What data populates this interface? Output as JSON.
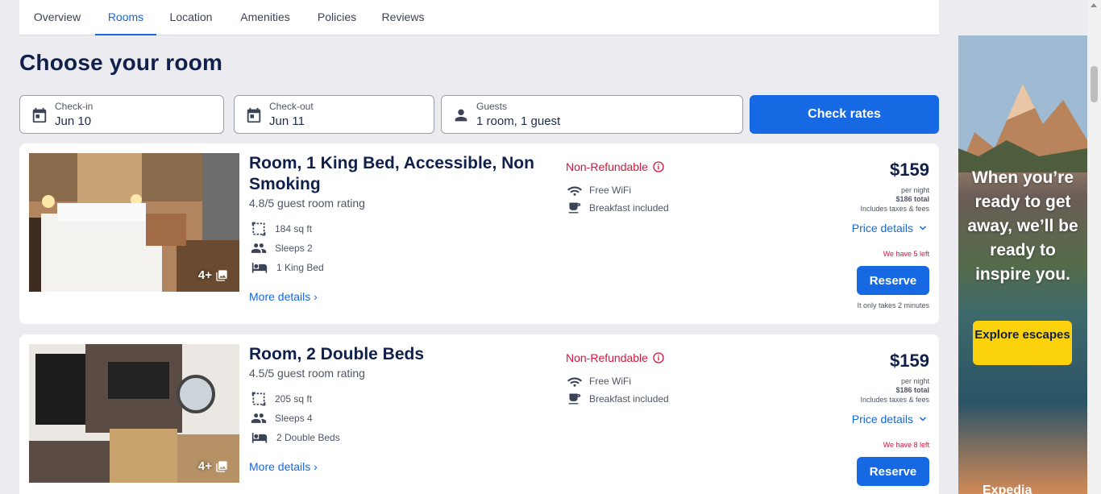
{
  "tabs": [
    {
      "label": "Overview",
      "active": false
    },
    {
      "label": "Rooms",
      "active": true
    },
    {
      "label": "Location",
      "active": false
    },
    {
      "label": "Amenities",
      "active": false
    },
    {
      "label": "Policies",
      "active": false
    },
    {
      "label": "Reviews",
      "active": false
    }
  ],
  "page_title": "Choose your room",
  "search": {
    "checkin": {
      "label": "Check-in",
      "value": "Jun 10",
      "icon": "calendar-icon"
    },
    "checkout": {
      "label": "Check-out",
      "value": "Jun 11",
      "icon": "calendar-icon"
    },
    "guests": {
      "label": "Guests",
      "value": "1 room, 1 guest",
      "icon": "person-icon"
    },
    "button_label": "Check rates"
  },
  "rooms": [
    {
      "name": "Room, 1 King Bed, Accessible, Non Smoking",
      "rating": "4.8/5 guest room rating",
      "photo_count": "4+",
      "size": "184 sq ft",
      "sleeps": "Sleeps 2",
      "beds": "1 King Bed",
      "more_details": "More details",
      "refund_policy": "Non-Refundable",
      "amenities": [
        "Free WiFi",
        "Breakfast included"
      ],
      "price": "$159",
      "per_night": "per night",
      "total": "$186 total",
      "taxes": "Includes taxes & fees",
      "price_details": "Price details",
      "availability": "We have 5 left",
      "reserve_label": "Reserve",
      "takes": "It only takes 2 minutes"
    },
    {
      "name": "Room, 2 Double Beds",
      "rating": "4.5/5 guest room rating",
      "photo_count": "4+",
      "size": "205 sq ft",
      "sleeps": "Sleeps 4",
      "beds": "2 Double Beds",
      "more_details": "More details",
      "refund_policy": "Non-Refundable",
      "amenities": [
        "Free WiFi",
        "Breakfast included"
      ],
      "price": "$159",
      "per_night": "per night",
      "total": "$186 total",
      "taxes": "Includes taxes & fees",
      "price_details": "Price details",
      "availability": "We have 8 left",
      "reserve_label": "Reserve"
    }
  ],
  "ad": {
    "headline": "When you’re ready to get away, we’ll be ready to inspire you.",
    "button_label": "Explore escapes",
    "logo": "Expedia"
  },
  "colors": {
    "accent": "#1668e3",
    "refund": "#d3173c",
    "heading": "#10204b",
    "ad_button": "#fcd20c"
  }
}
